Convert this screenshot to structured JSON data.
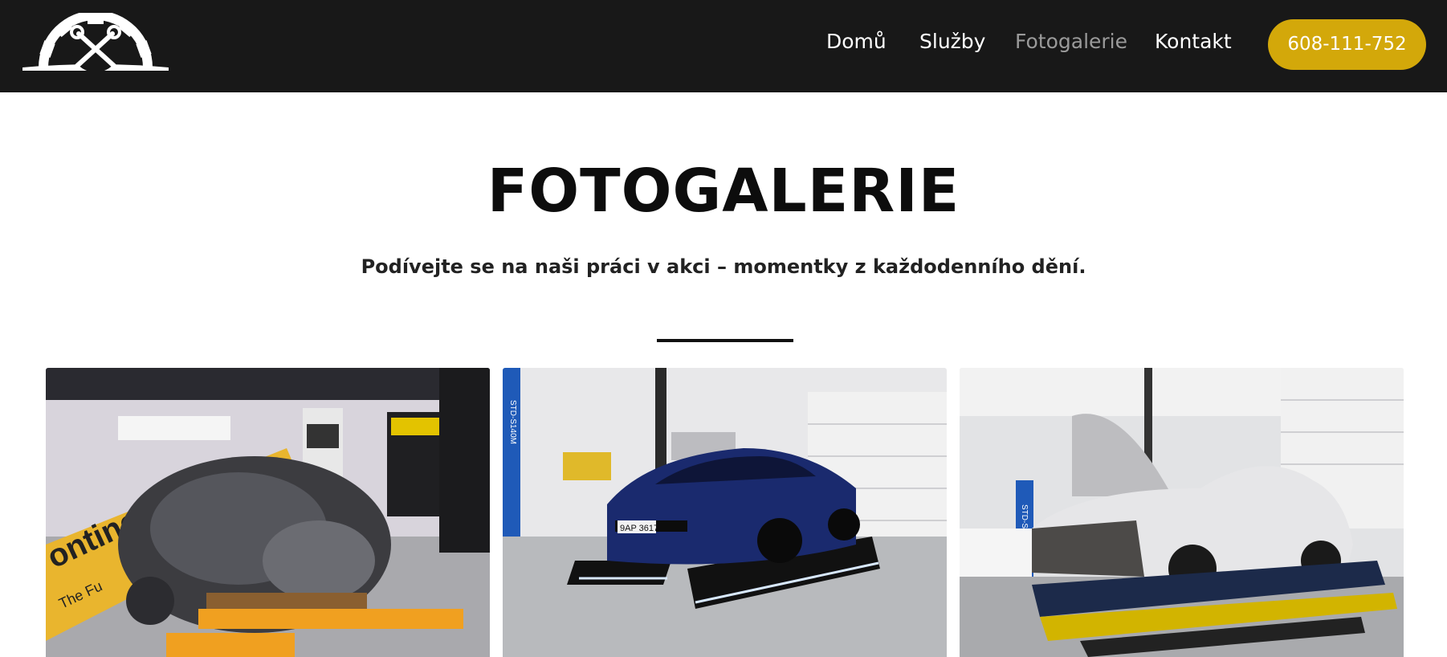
{
  "header": {
    "logo_icon": "gear-wrench-logo-icon",
    "nav": [
      {
        "label": "Domů",
        "active": false
      },
      {
        "label": "Služby",
        "active": false
      },
      {
        "label": "Fotogalerie",
        "active": true
      },
      {
        "label": "Kontakt",
        "active": false
      }
    ],
    "phone_label": "608-111-752",
    "accent_color": "#d3a80a",
    "background_color": "#181818"
  },
  "main": {
    "title": "FOTOGALERIE",
    "subtitle": "Podívejte se na naši práci v akci – momentky z každodenního dění.",
    "gallery": [
      {
        "photo": "engine-on-lift-photo",
        "banner_text": "ontinental",
        "banner_subtext": "The Fu"
      },
      {
        "photo": "blue-car-on-platform-photo",
        "plate_text": "9AP 3617",
        "column_text": "STD-S140M"
      },
      {
        "photo": "white-car-on-lift-photo",
        "column_text": "STD-S140M"
      }
    ]
  }
}
